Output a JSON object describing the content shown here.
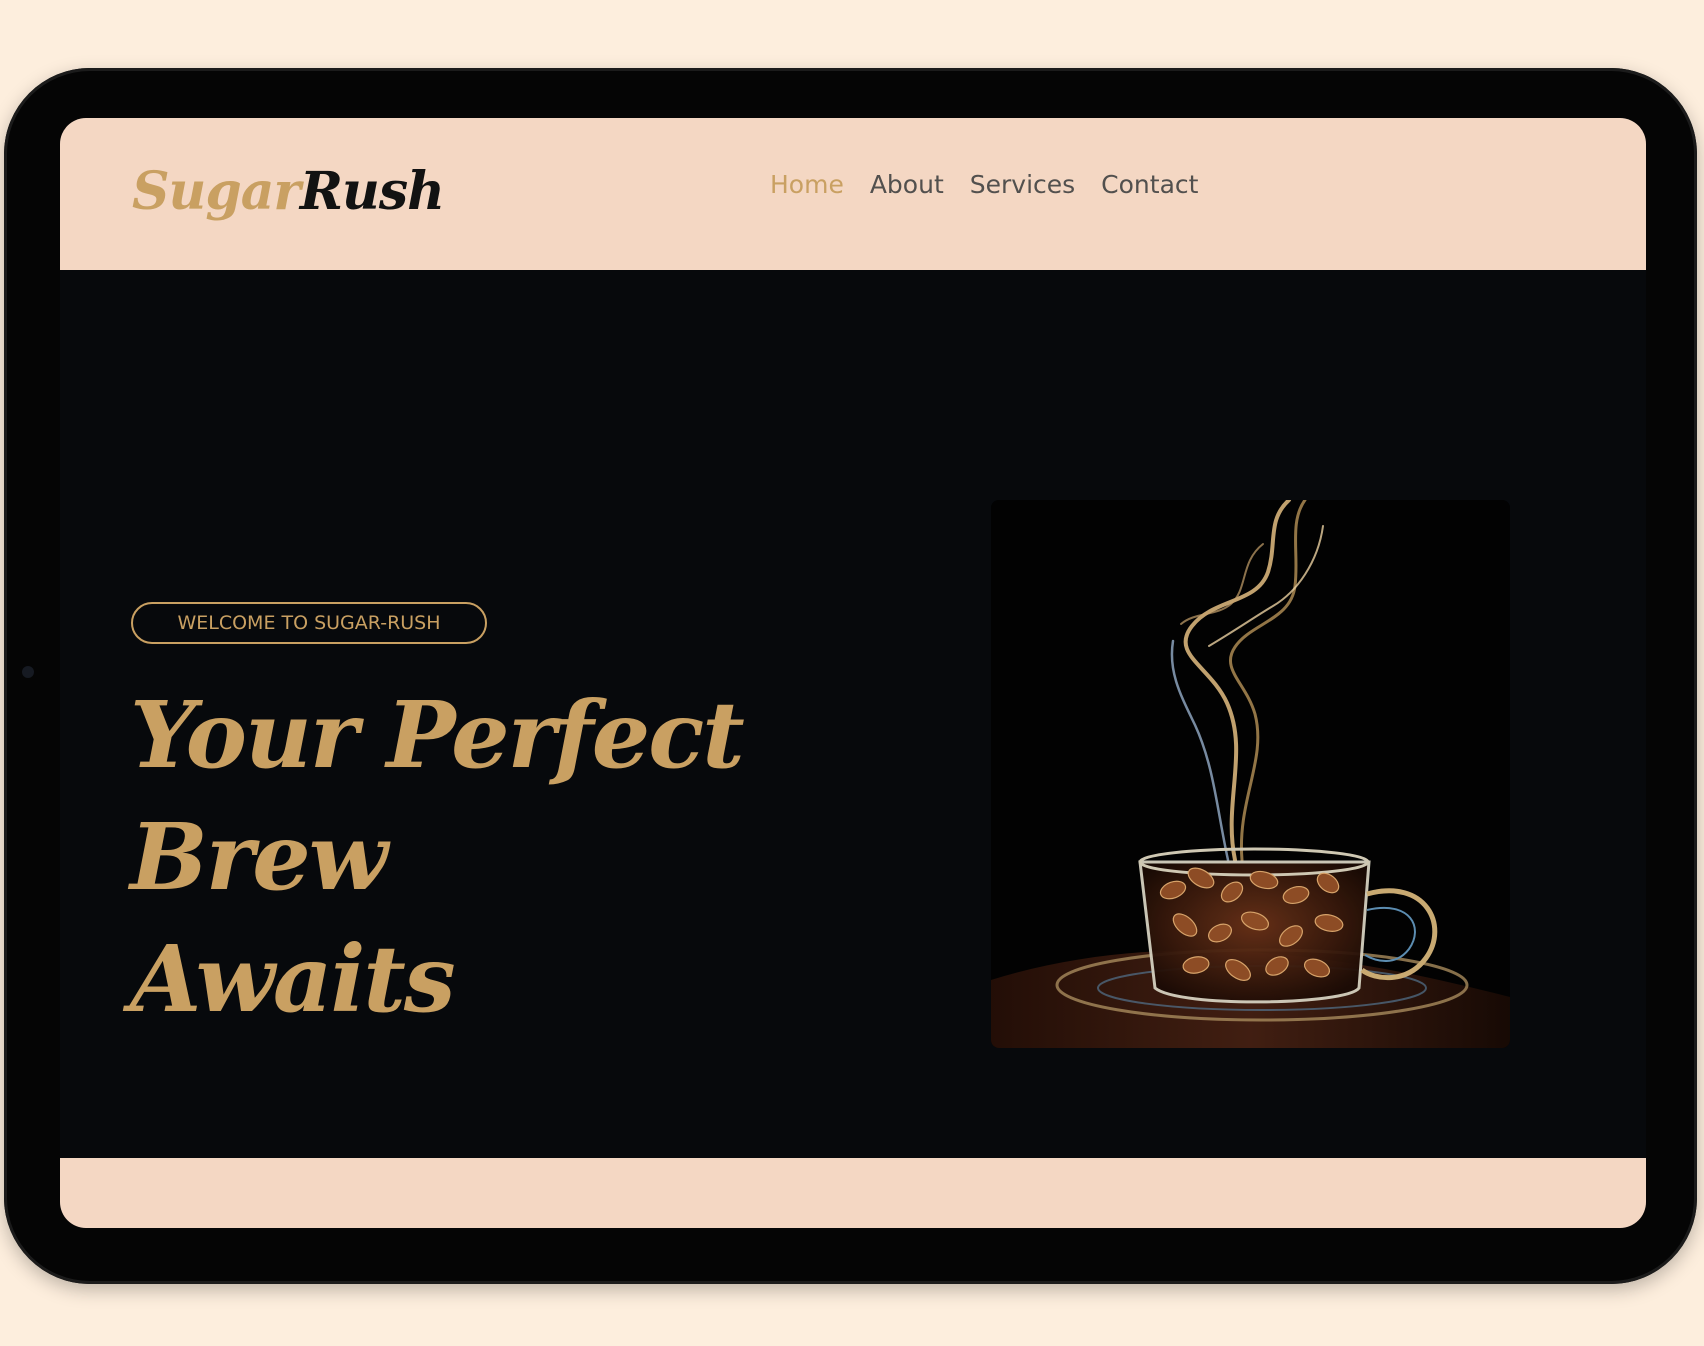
{
  "brand": {
    "logo_part1": "Sugar",
    "logo_part2": "Rush"
  },
  "nav": {
    "items": [
      {
        "label": "Home",
        "active": true
      },
      {
        "label": "About",
        "active": false
      },
      {
        "label": "Services",
        "active": false
      },
      {
        "label": "Contact",
        "active": false
      }
    ]
  },
  "hero": {
    "badge": "WELCOME TO SUGAR-RUSH",
    "title_line1": "Your Perfect Brew",
    "title_line2": "Awaits",
    "image_icon": "coffee-cup-with-beans-and-steam"
  },
  "colors": {
    "accent": "#c9a062",
    "header_bg": "#f4d7c3",
    "hero_bg": "#07090c",
    "nav_text": "#52504e",
    "page_bg": "#fdeedd"
  }
}
